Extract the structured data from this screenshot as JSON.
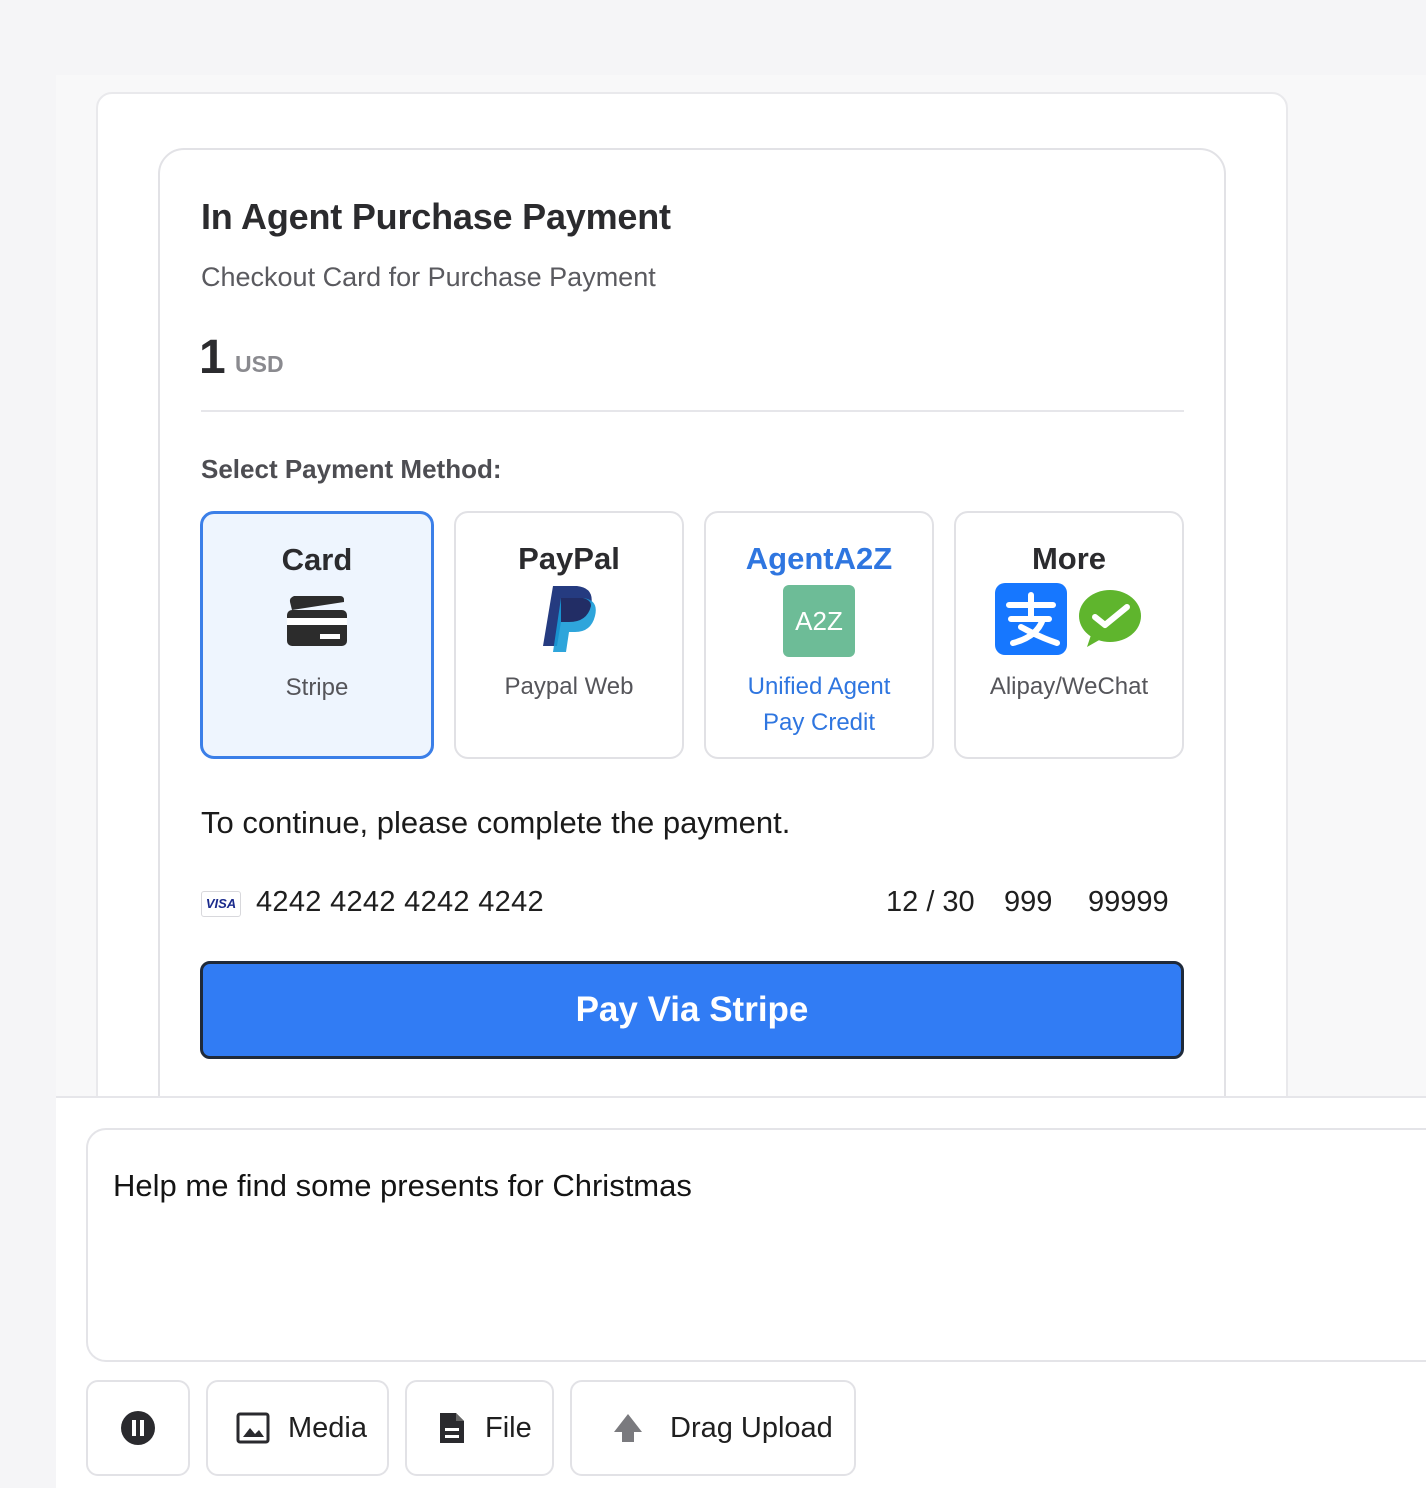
{
  "payment": {
    "title": "In Agent Purchase Payment",
    "subtitle": "Checkout Card for Purchase Payment",
    "amount": "1",
    "currency": "USD",
    "method_heading": "Select Payment Method:",
    "methods": [
      {
        "title": "Card",
        "subtitle": "Stripe",
        "icon": "credit-card-icon",
        "selected": true
      },
      {
        "title": "PayPal",
        "subtitle": "Paypal Web",
        "icon": "paypal-icon",
        "selected": false
      },
      {
        "title": "AgentA2Z",
        "subtitle": "Unified Agent Pay Credit",
        "icon_text": "A2Z",
        "icon": "agenta2z-icon",
        "selected": false
      },
      {
        "title": "More",
        "subtitle": "Alipay/WeChat",
        "icon": "alipay-wechat-icon",
        "selected": false
      }
    ],
    "instruction": "To continue, please complete the payment.",
    "card": {
      "brand": "VISA",
      "number": "4242 4242 4242 4242",
      "expiry": "12 / 30",
      "cvc": "999",
      "zip": "99999"
    },
    "pay_button": "Pay Via Stripe"
  },
  "composer": {
    "text": "Help me find some presents for Christmas",
    "tools": [
      {
        "label": "",
        "icon": "pause-icon"
      },
      {
        "label": "Media",
        "icon": "image-icon"
      },
      {
        "label": "File",
        "icon": "file-icon"
      },
      {
        "label": "Drag Upload",
        "icon": "upload-arrow-icon"
      }
    ]
  },
  "colors": {
    "accent": "#317cf4",
    "selected_bg": "#eef5fe",
    "link_blue": "#2f76e0",
    "a2z_green": "#6dbc97",
    "alipay_blue": "#1677ff",
    "wechat_green": "#5fb52d"
  }
}
